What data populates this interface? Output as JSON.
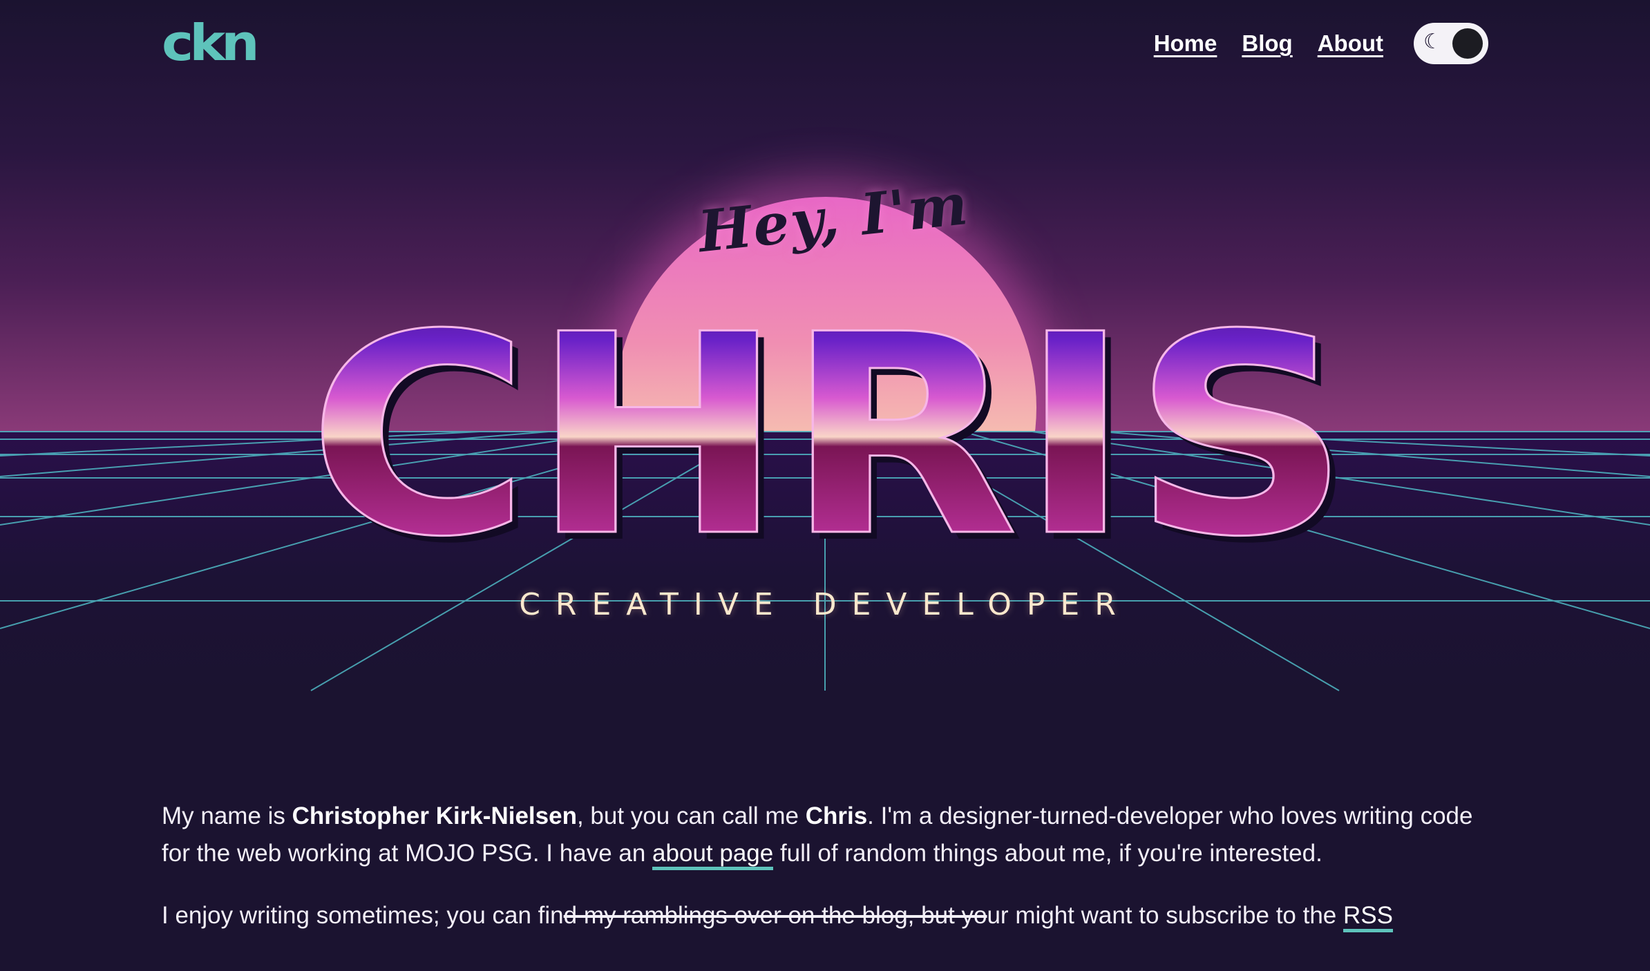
{
  "header": {
    "logo": "ckn",
    "nav": [
      {
        "label": "Home"
      },
      {
        "label": "Blog"
      },
      {
        "label": "About"
      }
    ],
    "theme_toggle": {
      "icon": "moon-icon",
      "state": "dark"
    }
  },
  "hero": {
    "greeting": "Hey, I'm",
    "name": "CHRIS",
    "subtitle": "CREATIVE DEVELOPER"
  },
  "intro": {
    "p1": {
      "t1": "My name is ",
      "full_name": "Christopher Kirk-Nielsen",
      "t2": ", but you can call me ",
      "nickname": "Chris",
      "t3": ". I'm a designer-turned-developer who loves writing code for the web working at MOJO PSG. I have an ",
      "about_link": "about page",
      "t4": " full of random things about me, if you're interested."
    },
    "p2": {
      "t1": "I enjoy writing sometimes; you can fin",
      "strike": "d my ramblings over on the blog, but yo",
      "t2": "ur might want to subscribe to the ",
      "rss_link": "RSS"
    }
  },
  "colors": {
    "accent": "#5ec3bb",
    "background": "#1b1330",
    "sun_top": "#e868c6",
    "sun_bottom": "#fbe6c6",
    "grid": "#4fb8c4",
    "title_purple": "#6a22c8",
    "title_pink": "#d23aa6"
  }
}
